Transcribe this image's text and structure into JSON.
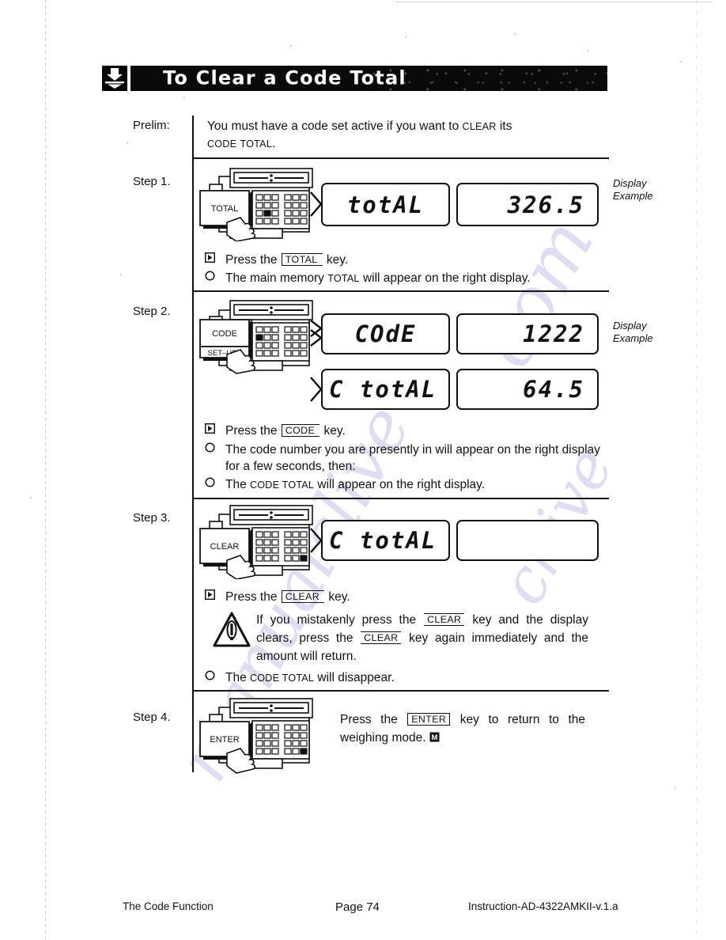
{
  "banner": {
    "icon": "down-arrow-icon",
    "title": "To Clear a Code Total"
  },
  "prelim": {
    "label": "Prelim:",
    "line1_a": "You must have a code set active if you want to ",
    "line1_sc": "CLEAR",
    "line1_b": " its",
    "line2_sc1": "CODE",
    "line2_sc2": "TOTAL",
    "line2_end": "."
  },
  "steps": [
    {
      "label": "Step 1.",
      "key": "TOTAL",
      "sublabel": "",
      "display_example": "Display\nExample",
      "displays": [
        {
          "left": "totAL",
          "right": "326.5"
        }
      ],
      "instructions": [
        {
          "mark": "play",
          "pre": "Press the ",
          "key": "TOTAL",
          "post": " key."
        },
        {
          "mark": "circle",
          "pre": "The main memory ",
          "sc": "TOTAL",
          "post": " will appear on the right display."
        }
      ]
    },
    {
      "label": "Step 2.",
      "key": "CODE",
      "sublabel": "SET-UP",
      "display_example": "Display\nExample",
      "displays": [
        {
          "left": "COdE",
          "right": "1222"
        },
        {
          "left": "C totAL",
          "right": "64.5"
        }
      ],
      "instructions": [
        {
          "mark": "play",
          "pre": "Press the ",
          "key": "CODE",
          "post": " key."
        },
        {
          "mark": "circle",
          "pre": "The code number you are presently in will appear on the right display for a few seconds, then:"
        },
        {
          "mark": "circle",
          "pre": "The ",
          "sc": "CODE TOTAL",
          "post": " will appear on the right display."
        }
      ]
    },
    {
      "label": "Step 3.",
      "key": "CLEAR",
      "sublabel": "",
      "display_example": "",
      "displays": [
        {
          "left": "C totAL",
          "right": ""
        }
      ],
      "instructions": [
        {
          "mark": "play",
          "pre": "Press the ",
          "key": "CLEAR",
          "post": " key."
        },
        {
          "mark": "circle",
          "pre": "The ",
          "sc": "CODE TOTAL",
          "post": " will disappear."
        }
      ]
    },
    {
      "label": "Step 4.",
      "key": "ENTER",
      "sublabel": "",
      "display_example": "",
      "displays": [],
      "instructions": []
    }
  ],
  "warning": {
    "icon": "warning-triangle-icon",
    "t1": "If you mistakenly press the ",
    "k1": "CLEAR",
    "t2": " key and the display clears, press the ",
    "k2": "CLEAR",
    "t3": " key again immediately and the amount will return."
  },
  "step4_text": {
    "pre": "Press the ",
    "key": "ENTER",
    "mid": " key to return to the weighing mode. ",
    "end_icon": "end-of-section-icon"
  },
  "footer": {
    "left": "The Code Function",
    "center": "Page 74",
    "right": "Instruction-AD-4322AMKII-v.1.a"
  }
}
